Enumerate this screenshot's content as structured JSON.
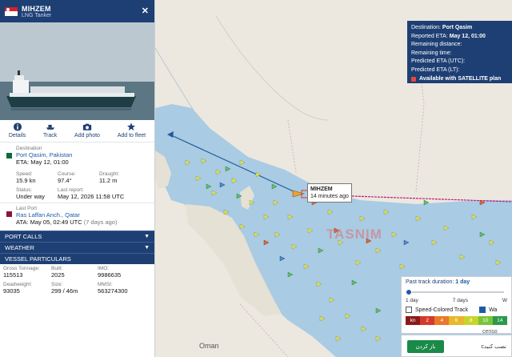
{
  "vessel": {
    "name": "MIHZEM",
    "type": "LNG Tanker",
    "map_label_name": "MIHZEM",
    "map_label_time": "14 minutes ago"
  },
  "actions": [
    {
      "label": "Details",
      "icon": "info-icon"
    },
    {
      "label": "Track",
      "icon": "ship-track-icon"
    },
    {
      "label": "Add photo",
      "icon": "camera-icon"
    },
    {
      "label": "Add to fleet",
      "icon": "star-icon"
    }
  ],
  "destination": {
    "label": "Destination",
    "name": "Port Qasim, Pakistan",
    "eta": "ETA: May 12, 01:00"
  },
  "stats": {
    "speed_label": "Speed:",
    "speed": "15.9 kn",
    "course_label": "Course:",
    "course": "97.4°",
    "draught_label": "Draught:",
    "draught": "11.2 m",
    "status_label": "Status:",
    "status": "Under way",
    "last_report_label": "Last report:",
    "last_report": "May 12, 2026 11:58 UTC"
  },
  "last_port": {
    "label": "Last Port",
    "name": "Ras Laffan Anch., Qatar",
    "ata": "ATA: May 05, 02:49 UTC",
    "ago": "(7 days ago)"
  },
  "sections": [
    "PORT CALLS",
    "WEATHER",
    "VESSEL PARTICULARS"
  ],
  "particulars": {
    "gross_label": "Gross Tonnage:",
    "gross": "115513",
    "built_label": "Built:",
    "built": "2025",
    "imo_label": "IMO:",
    "imo": "9986635",
    "dwt_label": "Deadweight:",
    "dwt": "93035",
    "size_label": "Size:",
    "size": "299 / 46m",
    "mmsi_label": "MMSI:",
    "mmsi": "563274300"
  },
  "eta_box": {
    "dest_label": "Destination:",
    "dest": "Port Qasim",
    "reported_label": "Reported ETA:",
    "reported": "May 12, 01:00",
    "remaining_distance": "Remaining distance:",
    "remaining_time": "Remaining time:",
    "predicted_utc": "Predicted ETA (UTC):",
    "predicted_lt": "Predicted ETA (LT):",
    "satellite": "Available with SATELLITE plan"
  },
  "track_panel": {
    "duration_label": "Past track duration:",
    "duration": "1 day",
    "ticks": [
      "1 day",
      "7 days",
      "W"
    ],
    "speed_colored": "Speed-Colored Track",
    "wa_label": "Wa",
    "legend": [
      "kn",
      "2",
      "4",
      "6",
      "8",
      "10",
      "14"
    ]
  },
  "map_labels": {
    "oman": "Oman",
    "watermark": "TASNIM",
    "censor": "censo",
    "farsi_button": "باز کردن",
    "farsi_text": "cنصب کنید"
  },
  "colors": {
    "brand": "#1d3f73",
    "link": "#1d5ba8",
    "sea": "#a9cbe3",
    "track": "#c2187a",
    "land": "#ece8df"
  }
}
